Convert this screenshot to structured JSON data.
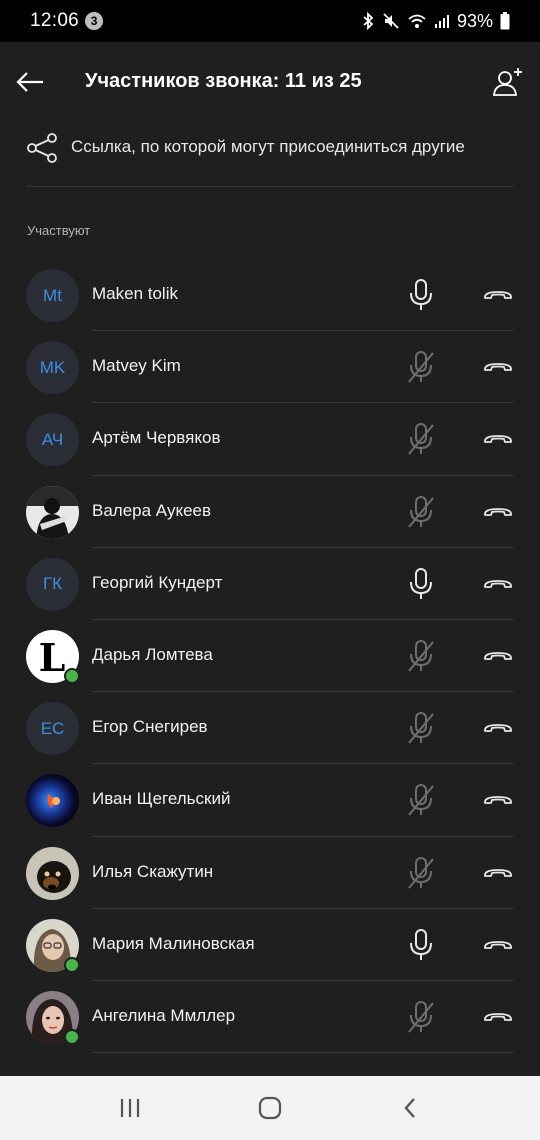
{
  "status_bar": {
    "time": "12:06",
    "notification_count": "3",
    "battery": "93%"
  },
  "header": {
    "title": "Участников звонка: 11 из 25",
    "back_icon": "arrow-left-icon",
    "add_icon": "add-person-icon"
  },
  "invite_link": {
    "label": "Ссылка, по которой могут присоединиться другие",
    "icon": "share-icon"
  },
  "section": {
    "label": "Участвуют"
  },
  "participants": [
    {
      "name": "Maken tolik",
      "initials": "Mt",
      "avatar": "initials",
      "online": false,
      "mic": "on"
    },
    {
      "name": "Matvey Kim",
      "initials": "MK",
      "avatar": "initials",
      "online": false,
      "mic": "off"
    },
    {
      "name": "Артём Червяков",
      "initials": "АЧ",
      "avatar": "initials",
      "online": false,
      "mic": "off"
    },
    {
      "name": "Валера Аукеев",
      "initials": "",
      "avatar": "photo-bw-figure",
      "online": false,
      "mic": "off"
    },
    {
      "name": "Георгий Кундерт",
      "initials": "ГК",
      "avatar": "initials",
      "online": false,
      "mic": "on"
    },
    {
      "name": "Дарья Ломтева",
      "initials": "",
      "avatar": "photo-gothic-letter-l",
      "online": true,
      "mic": "off"
    },
    {
      "name": "Егор Снегирев",
      "initials": "ЕС",
      "avatar": "initials",
      "online": false,
      "mic": "off"
    },
    {
      "name": "Иван Щегельский",
      "initials": "",
      "avatar": "photo-planet",
      "online": false,
      "mic": "off"
    },
    {
      "name": "Илья Скажутин",
      "initials": "",
      "avatar": "photo-dog",
      "online": false,
      "mic": "off"
    },
    {
      "name": "Мария Малиновская",
      "initials": "",
      "avatar": "photo-girl-light",
      "online": true,
      "mic": "on"
    },
    {
      "name": "Ангелина Ммллер",
      "initials": "",
      "avatar": "photo-girl-dark",
      "online": true,
      "mic": "off"
    }
  ],
  "nav_bar": {
    "recents_icon": "recents-icon",
    "home_icon": "home-icon",
    "back_icon": "nav-back-icon"
  },
  "colors": {
    "background": "#1f1f20",
    "accent": "#3d8fde",
    "online": "#4bb34b",
    "divider": "#36373a"
  }
}
